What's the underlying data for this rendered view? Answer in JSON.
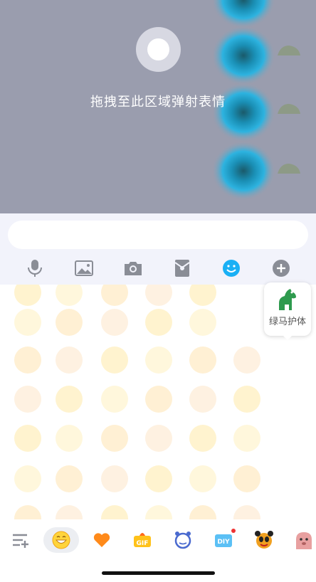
{
  "overlay": {
    "hint_text": "拖拽至此区域弹射表情"
  },
  "input": {
    "value": "",
    "placeholder": ""
  },
  "toolbar": {
    "buttons": [
      "microphone-icon",
      "image-icon",
      "camera-icon",
      "red-packet-icon",
      "emoji-icon",
      "plus-icon"
    ],
    "active_color": "#1ab0f5",
    "icon_color": "#8a8d96"
  },
  "favorite_popup": {
    "label": "绿马护体"
  },
  "bottom_tabs": {
    "items": [
      "manage-icon",
      "emoji-face-icon",
      "heart-icon",
      "gif-icon",
      "clock-mascot-icon",
      "diy-icon",
      "panda-mascot-icon",
      "pink-monster-icon"
    ],
    "gif_label": "GIF",
    "diy_label": "DIY"
  },
  "colors": {
    "overlay_bg": "#9a9dae",
    "input_area_bg": "#f2f3fb",
    "accent": "#1ab0f5",
    "emoji_yellow": "#ffd43b",
    "heart_orange": "#ff8a1a"
  }
}
